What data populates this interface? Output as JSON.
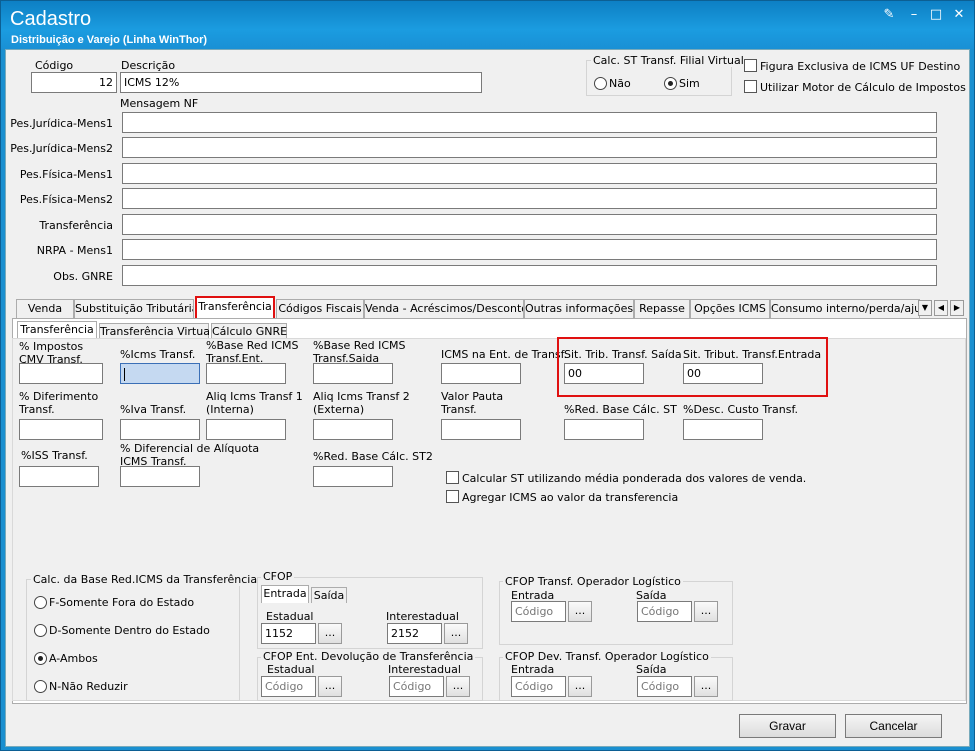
{
  "window": {
    "title": "Cadastro",
    "subtitle": "Distribuição e Varejo (Linha WinThor)"
  },
  "header": {
    "codigo_label": "Código",
    "codigo_value": "12",
    "descricao_label": "Descrição",
    "descricao_value": "ICMS 12%",
    "calc_st_label": "Calc. ST Transf. Filial Virtual",
    "nao_label": "Não",
    "sim_label": "Sim",
    "selected": "Sim",
    "figura_label": "Figura Exclusiva de ICMS UF Destino",
    "motor_label": "Utilizar Motor de Cálculo de Impostos",
    "mensagem_label": "Mensagem NF"
  },
  "messages": [
    {
      "label": "Pes.Jurídica-Mens1",
      "value": ""
    },
    {
      "label": "Pes.Jurídica-Mens2",
      "value": ""
    },
    {
      "label": "Pes.Física-Mens1",
      "value": ""
    },
    {
      "label": "Pes.Física-Mens2",
      "value": ""
    },
    {
      "label": "Transferência",
      "value": ""
    },
    {
      "label": "NRPA - Mens1",
      "value": ""
    },
    {
      "label": "Obs. GNRE",
      "value": ""
    }
  ],
  "tabs": [
    "Venda",
    "Substituição Tributária",
    "Transferência",
    "Códigos Fiscais",
    "Venda - Acréscimos/Descontos",
    "Outras informações",
    "Repasse",
    "Opções ICMS",
    "Consumo interno/perda/ajuste"
  ],
  "active_tab": "Transferência",
  "subtabs": [
    "Transferência",
    "Transferência Virtual",
    "Cálculo GNRE"
  ],
  "fields": {
    "impostos_cmv": "% Impostos\nCMV Transf.",
    "icms_transf": "%Icms Transf.",
    "base_red_ent": "%Base Red ICMS\nTransf.Ent.",
    "base_red_saida": "%Base Red ICMS\nTransf.Saida",
    "icms_ent_transf": "ICMS na Ent. de Transf.",
    "sit_trib_saida": "Sit. Trib. Transf. Saída",
    "sit_trib_saida_value": "00",
    "sit_trib_entrada": "Sit. Tribut. Transf.Entrada",
    "sit_trib_entrada_value": "00",
    "diferimento": "% Diferimento\nTransf.",
    "iva_transf": "%Iva Transf.",
    "aliq1": "Aliq Icms Transf 1\n(Interna)",
    "aliq2": "Aliq Icms Transf 2\n(Externa)",
    "valor_pauta": "Valor Pauta\nTransf.",
    "red_base_st": "%Red. Base Cálc. ST",
    "desc_custo": "%Desc. Custo Transf.",
    "iss_transf": "%ISS  Transf.",
    "dif_aliquota": "% Diferencial de Alíquota\nICMS Transf.",
    "red_base_st2": "%Red. Base Cálc. ST2",
    "calc_st_media": "Calcular ST utilizando média ponderada dos valores de venda.",
    "agregar_icms": "Agregar ICMS ao valor da transferencia"
  },
  "calc_base": {
    "title": "Calc. da Base Red.ICMS da Transferência",
    "options": [
      "F-Somente Fora do Estado",
      "D-Somente Dentro do Estado",
      "A-Ambos",
      "N-Não Reduzir"
    ],
    "selected": "A-Ambos"
  },
  "cfop": {
    "title": "CFOP",
    "tab_entrada": "Entrada",
    "tab_saida": "Saída",
    "estadual_label": "Estadual",
    "estadual_value": "1152",
    "interestadual_label": "Interestadual",
    "interestadual_value": "2152",
    "btn": "..."
  },
  "cfop_dev": {
    "title": "CFOP Ent. Devolução de Transferência",
    "estadual_label": "Estadual",
    "interestadual_label": "Interestadual",
    "placeholder": "Código"
  },
  "cfop_op": {
    "title": "CFOP Transf. Operador Logístico",
    "entrada_label": "Entrada",
    "saida_label": "Saída",
    "placeholder": "Código"
  },
  "cfop_dev_op": {
    "title": "CFOP Dev. Transf. Operador Logístico",
    "entrada_label": "Entrada",
    "saida_label": "Saída",
    "placeholder": "Código"
  },
  "buttons": {
    "gravar": "Gravar",
    "cancelar": "Cancelar"
  },
  "colors": {
    "titlebar": "#1b9ce0",
    "highlight": "#e01010"
  }
}
